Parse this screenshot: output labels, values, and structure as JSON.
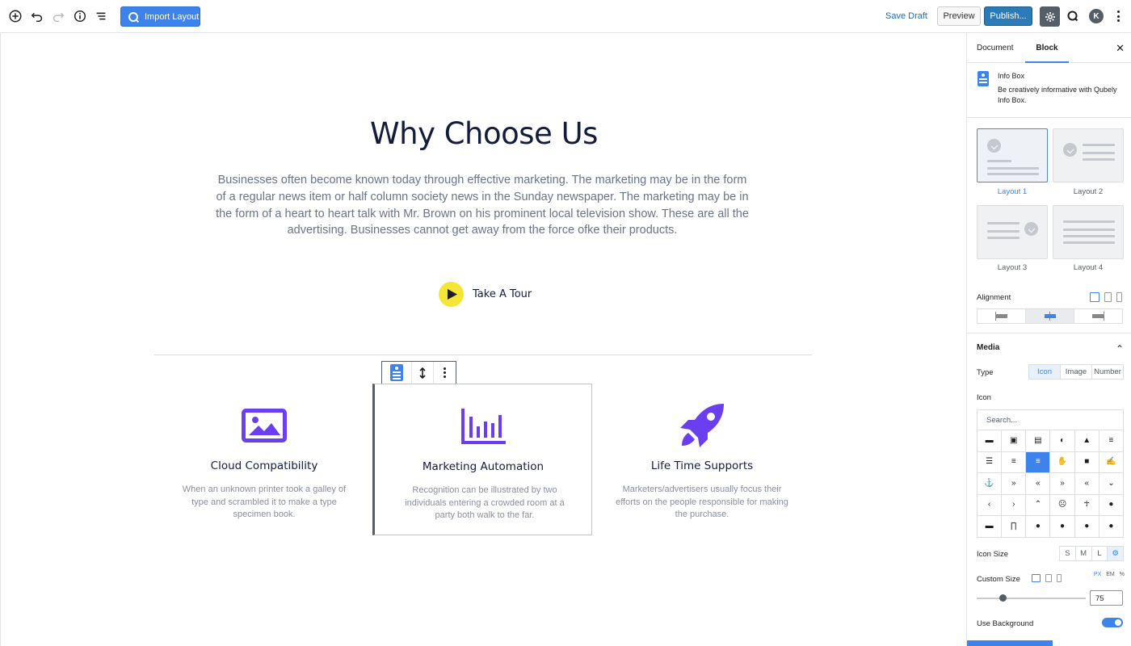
{
  "topbar": {
    "import_label": "Import Layout",
    "save_draft": "Save Draft",
    "preview": "Preview",
    "publish": "Publish...",
    "avatar_initial": "K"
  },
  "content": {
    "headline": "Why Choose Us",
    "lead": "Businesses often become known today through effective marketing. The marketing may be in the form of a regular news item or half column society news in the Sunday newspaper. The marketing may be in the form of a heart to heart talk with Mr. Brown on his prominent local television show. These are all the advertising. Businesses cannot get away from the force ofke their products.",
    "tour_label": "Take A Tour",
    "cards": [
      {
        "title": "Cloud Compatibility",
        "text": "When an unknown printer took a galley of type and scrambled it to make a type specimen book.",
        "icon": "image-icon"
      },
      {
        "title": "Marketing Automation",
        "text": "Recognition can be illustrated by two individuals entering a crowded room at a party both walk to the far.",
        "icon": "bar-chart-icon"
      },
      {
        "title": "Life Time Supports",
        "text": "Marketers/advertisers usually focus their efforts on the people responsible for making the purchase.",
        "icon": "rocket-icon"
      }
    ],
    "accent_color": "#6a3ff0",
    "tour_color": "#f5e535"
  },
  "sidebar": {
    "tabs": [
      "Document",
      "Block"
    ],
    "active_tab": "Block",
    "block_name": "Info Box",
    "block_desc": "Be creatively informative with Qubely Info Box.",
    "layouts": [
      "Layout 1",
      "Layout 2",
      "Layout 3",
      "Layout 4"
    ],
    "active_layout": "Layout 1",
    "alignment_label": "Alignment",
    "media_label": "Media",
    "type_label": "Type",
    "type_options": [
      "Icon",
      "Image",
      "Number"
    ],
    "icon_label": "Icon",
    "search_placeholder": "Search...",
    "icon_size_label": "Icon Size",
    "size_options": [
      "S",
      "M",
      "L"
    ],
    "custom_size_label": "Custom Size",
    "units": [
      "PX",
      "EM",
      "%"
    ],
    "custom_size_value": "75",
    "use_background_label": "Use Background",
    "use_background": true,
    "accent": "#3c84ec"
  }
}
